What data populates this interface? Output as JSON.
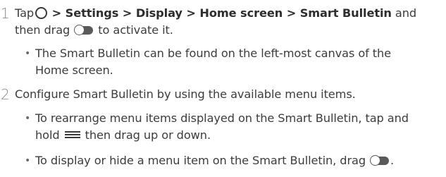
{
  "steps": [
    {
      "number": "1",
      "line1": {
        "prefix": "Tap",
        "sep1": " > ",
        "path1": "Settings",
        "sep2": " > ",
        "path2": "Display",
        "sep3": " > ",
        "path3": "Home screen",
        "sep4": " > ",
        "path4": "Smart Bulletin",
        "suffix": " and"
      },
      "line2": {
        "before": "then drag",
        "after": "to activate it."
      },
      "bullets": [
        {
          "line1": "The Smart Bulletin can be found on the left-most canvas of the",
          "line2": "Home screen."
        }
      ]
    },
    {
      "number": "2",
      "text": "Configure Smart Bulletin by using the available menu items.",
      "bullets": [
        {
          "line1": "To rearrange menu items displayed on the Smart Bulletin, tap and",
          "line2_before": "hold",
          "line2_after": "then drag up or down."
        },
        {
          "line1_before": "To display or hide a menu item on the Smart Bulletin, drag",
          "line1_after": "."
        }
      ]
    }
  ],
  "bullet_char": "•",
  "icons": {
    "home": "home-circle-icon",
    "toggle": "toggle-switch-icon",
    "menu": "reorder-handle-icon"
  }
}
